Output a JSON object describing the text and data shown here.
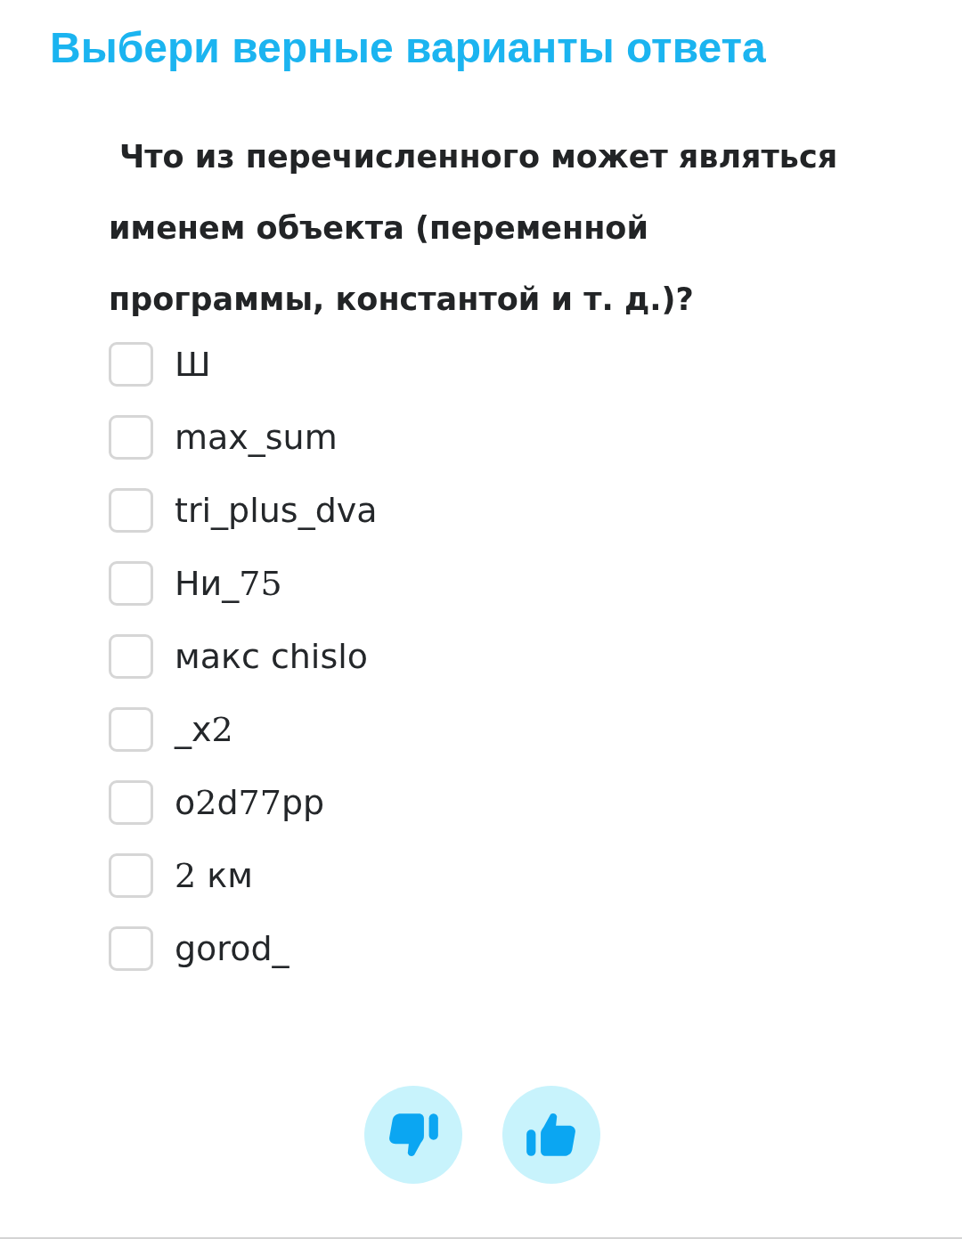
{
  "title": "Выбери верные варианты ответа",
  "question": "Что из перечисленного может являться именем объекта (переменной программы, константой и т. д.)?",
  "options": [
    {
      "checked": false,
      "segments": [
        {
          "kind": "text",
          "text": "Ш"
        }
      ]
    },
    {
      "checked": false,
      "segments": [
        {
          "kind": "text",
          "text": "max_sum"
        }
      ]
    },
    {
      "checked": false,
      "segments": [
        {
          "kind": "text",
          "text": "tri_plus_dva"
        }
      ]
    },
    {
      "checked": false,
      "segments": [
        {
          "kind": "text",
          "text": "Ни_"
        },
        {
          "kind": "math",
          "text": "75"
        }
      ]
    },
    {
      "checked": false,
      "segments": [
        {
          "kind": "text",
          "text": "макс chislo"
        }
      ]
    },
    {
      "checked": false,
      "segments": [
        {
          "kind": "text",
          "text": "_x"
        },
        {
          "kind": "math",
          "text": "2"
        }
      ]
    },
    {
      "checked": false,
      "segments": [
        {
          "kind": "text",
          "text": "o"
        },
        {
          "kind": "math",
          "text": "2"
        },
        {
          "kind": "text",
          "text": "d"
        },
        {
          "kind": "math",
          "text": "77"
        },
        {
          "kind": "text",
          "text": "pp"
        }
      ]
    },
    {
      "checked": false,
      "segments": [
        {
          "kind": "math",
          "text": "2"
        },
        {
          "kind": "text",
          "text": " км"
        }
      ]
    },
    {
      "checked": false,
      "segments": [
        {
          "kind": "text",
          "text": "gorod_"
        }
      ]
    }
  ]
}
